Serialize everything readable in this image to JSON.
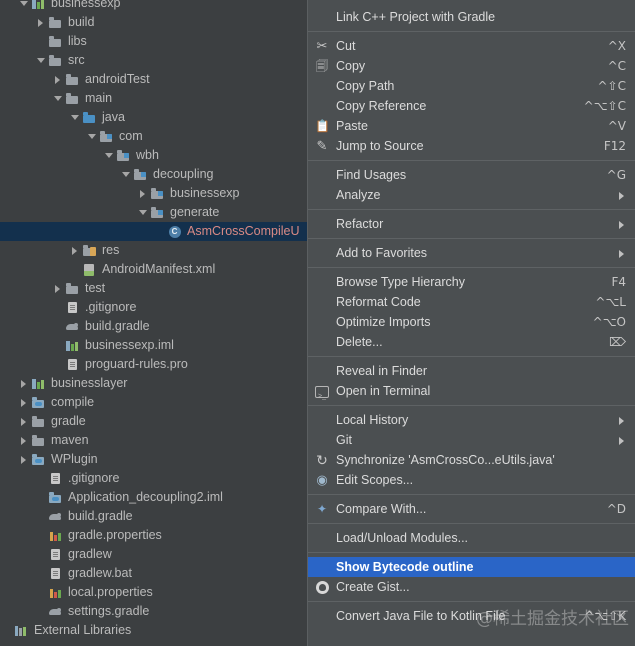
{
  "project_tree": {
    "rows": [
      {
        "label": "businessexp",
        "indent": 1,
        "arrow": "open",
        "icon": "module"
      },
      {
        "label": "build",
        "indent": 2,
        "arrow": "closed",
        "icon": "folder"
      },
      {
        "label": "libs",
        "indent": 2,
        "arrow": "none",
        "icon": "folder"
      },
      {
        "label": "src",
        "indent": 2,
        "arrow": "open",
        "icon": "folder"
      },
      {
        "label": "androidTest",
        "indent": 3,
        "arrow": "closed",
        "icon": "folder"
      },
      {
        "label": "main",
        "indent": 3,
        "arrow": "open",
        "icon": "folder"
      },
      {
        "label": "java",
        "indent": 4,
        "arrow": "open",
        "icon": "javafolder"
      },
      {
        "label": "com",
        "indent": 5,
        "arrow": "open",
        "icon": "srcfolder"
      },
      {
        "label": "wbh",
        "indent": 6,
        "arrow": "open",
        "icon": "srcfolder"
      },
      {
        "label": "decoupling",
        "indent": 7,
        "arrow": "open",
        "icon": "srcfolder"
      },
      {
        "label": "businessexp",
        "indent": 8,
        "arrow": "closed",
        "icon": "srcfolder"
      },
      {
        "label": "generate",
        "indent": 8,
        "arrow": "open",
        "icon": "srcfolder"
      },
      {
        "label": "AsmCrossCompileU",
        "indent": 9,
        "arrow": "none",
        "icon": "class",
        "selected": true
      },
      {
        "label": "res",
        "indent": 4,
        "arrow": "closed",
        "icon": "res"
      },
      {
        "label": "AndroidManifest.xml",
        "indent": 4,
        "arrow": "none",
        "icon": "manifest"
      },
      {
        "label": "test",
        "indent": 3,
        "arrow": "closed",
        "icon": "folder"
      },
      {
        "label": ".gitignore",
        "indent": 3,
        "arrow": "none",
        "icon": "file"
      },
      {
        "label": "build.gradle",
        "indent": 3,
        "arrow": "none",
        "icon": "gradle"
      },
      {
        "label": "businessexp.iml",
        "indent": 3,
        "arrow": "none",
        "icon": "module"
      },
      {
        "label": "proguard-rules.pro",
        "indent": 3,
        "arrow": "none",
        "icon": "file"
      },
      {
        "label": "businesslayer",
        "indent": 1,
        "arrow": "closed",
        "icon": "module"
      },
      {
        "label": "compile",
        "indent": 1,
        "arrow": "closed",
        "icon": "iml"
      },
      {
        "label": "gradle",
        "indent": 1,
        "arrow": "closed",
        "icon": "folder"
      },
      {
        "label": "maven",
        "indent": 1,
        "arrow": "closed",
        "icon": "folder"
      },
      {
        "label": "WPlugin",
        "indent": 1,
        "arrow": "closed",
        "icon": "iml"
      },
      {
        "label": ".gitignore",
        "indent": 2,
        "arrow": "none",
        "icon": "file"
      },
      {
        "label": "Application_decoupling2.iml",
        "indent": 2,
        "arrow": "none",
        "icon": "iml"
      },
      {
        "label": "build.gradle",
        "indent": 2,
        "arrow": "none",
        "icon": "gradle"
      },
      {
        "label": "gradle.properties",
        "indent": 2,
        "arrow": "none",
        "icon": "props"
      },
      {
        "label": "gradlew",
        "indent": 2,
        "arrow": "none",
        "icon": "file"
      },
      {
        "label": "gradlew.bat",
        "indent": 2,
        "arrow": "none",
        "icon": "file"
      },
      {
        "label": "local.properties",
        "indent": 2,
        "arrow": "none",
        "icon": "props"
      },
      {
        "label": "settings.gradle",
        "indent": 2,
        "arrow": "none",
        "icon": "gradle"
      },
      {
        "label": "External Libraries",
        "indent": 0,
        "arrow": "none",
        "icon": "extlib"
      }
    ],
    "selection_bg": "#13304d",
    "selection_text": "#d98a85"
  },
  "context_menu": {
    "highlight_color": "#2a65c7",
    "background": "#4b4f51",
    "items": [
      {
        "type": "item",
        "label": "Link C++ Project with Gradle",
        "shortcut": "",
        "icon": ""
      },
      {
        "type": "separator"
      },
      {
        "type": "item",
        "label": "Cut",
        "shortcut": "^X",
        "icon": "scissors-icon"
      },
      {
        "type": "item",
        "label": "Copy",
        "shortcut": "^C",
        "icon": "copy-icon"
      },
      {
        "type": "item",
        "label": "Copy Path",
        "shortcut": "^⇧C",
        "icon": ""
      },
      {
        "type": "item",
        "label": "Copy Reference",
        "shortcut": "^⌥⇧C",
        "icon": ""
      },
      {
        "type": "item",
        "label": "Paste",
        "shortcut": "^V",
        "icon": "paste-icon"
      },
      {
        "type": "item",
        "label": "Jump to Source",
        "shortcut": "F12",
        "icon": "pencil-icon"
      },
      {
        "type": "separator"
      },
      {
        "type": "item",
        "label": "Find Usages",
        "shortcut": "^G",
        "icon": ""
      },
      {
        "type": "item",
        "label": "Analyze",
        "shortcut": "",
        "icon": "",
        "submenu": true
      },
      {
        "type": "separator"
      },
      {
        "type": "item",
        "label": "Refactor",
        "shortcut": "",
        "icon": "",
        "submenu": true
      },
      {
        "type": "separator"
      },
      {
        "type": "item",
        "label": "Add to Favorites",
        "shortcut": "",
        "icon": "",
        "submenu": true
      },
      {
        "type": "separator"
      },
      {
        "type": "item",
        "label": "Browse Type Hierarchy",
        "shortcut": "F4",
        "icon": ""
      },
      {
        "type": "item",
        "label": "Reformat Code",
        "shortcut": "^⌥L",
        "icon": ""
      },
      {
        "type": "item",
        "label": "Optimize Imports",
        "shortcut": "^⌥O",
        "icon": ""
      },
      {
        "type": "item",
        "label": "Delete...",
        "shortcut": "⌦",
        "icon": ""
      },
      {
        "type": "separator"
      },
      {
        "type": "item",
        "label": "Reveal in Finder",
        "shortcut": "",
        "icon": ""
      },
      {
        "type": "item",
        "label": "Open in Terminal",
        "shortcut": "",
        "icon": "terminal-icon"
      },
      {
        "type": "separator"
      },
      {
        "type": "item",
        "label": "Local History",
        "shortcut": "",
        "icon": "",
        "submenu": true
      },
      {
        "type": "item",
        "label": "Git",
        "shortcut": "",
        "icon": "",
        "submenu": true
      },
      {
        "type": "item",
        "label": "Synchronize 'AsmCrossCo...eUtils.java'",
        "shortcut": "",
        "icon": "sync-icon"
      },
      {
        "type": "item",
        "label": "Edit Scopes...",
        "shortcut": "",
        "icon": "scope-icon"
      },
      {
        "type": "separator"
      },
      {
        "type": "item",
        "label": "Compare With...",
        "shortcut": "^D",
        "icon": "compare-icon"
      },
      {
        "type": "separator"
      },
      {
        "type": "item",
        "label": "Load/Unload Modules...",
        "shortcut": "",
        "icon": ""
      },
      {
        "type": "separator"
      },
      {
        "type": "item",
        "label": "Show Bytecode outline",
        "shortcut": "",
        "icon": "",
        "highlighted": true
      },
      {
        "type": "item",
        "label": "Create Gist...",
        "shortcut": "",
        "icon": "github-icon"
      },
      {
        "type": "separator"
      },
      {
        "type": "item",
        "label": "Convert Java File to Kotlin File",
        "shortcut": "^⌥⇧K",
        "icon": ""
      }
    ]
  },
  "watermark": {
    "text": "@稀土掘金技术社区"
  }
}
